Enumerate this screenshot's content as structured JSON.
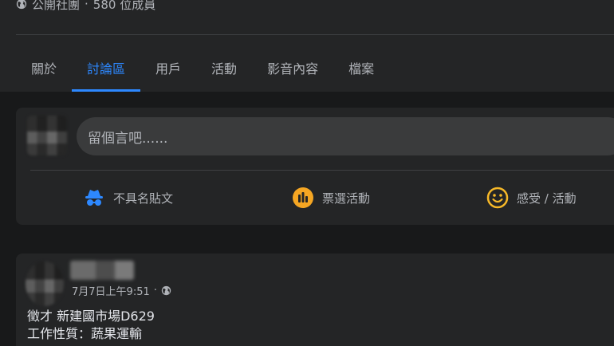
{
  "group": {
    "privacy": "公開社團",
    "separator": "·",
    "members": "580 位成員"
  },
  "tabs": [
    {
      "label": "關於",
      "active": false
    },
    {
      "label": "討論區",
      "active": true
    },
    {
      "label": "用戶",
      "active": false
    },
    {
      "label": "活動",
      "active": false
    },
    {
      "label": "影音內容",
      "active": false
    },
    {
      "label": "檔案",
      "active": false
    }
  ],
  "composer": {
    "placeholder": "留個言吧......",
    "actions": [
      {
        "label": "不具名貼文",
        "icon": "incognito-icon",
        "color": "#2d88ff"
      },
      {
        "label": "票選活動",
        "icon": "poll-icon",
        "color": "#f7b928"
      },
      {
        "label": "感受 / 活動",
        "icon": "smile-icon",
        "color": "#f7b928"
      }
    ]
  },
  "post": {
    "timestamp": "7月7日上午9:51",
    "separator": "·",
    "body_lines": [
      "徵才 新建國市場D629",
      "工作性質：蔬果運輸"
    ]
  },
  "colors": {
    "accent": "#2d88ff",
    "background": "#18191a",
    "surface": "#242526"
  }
}
